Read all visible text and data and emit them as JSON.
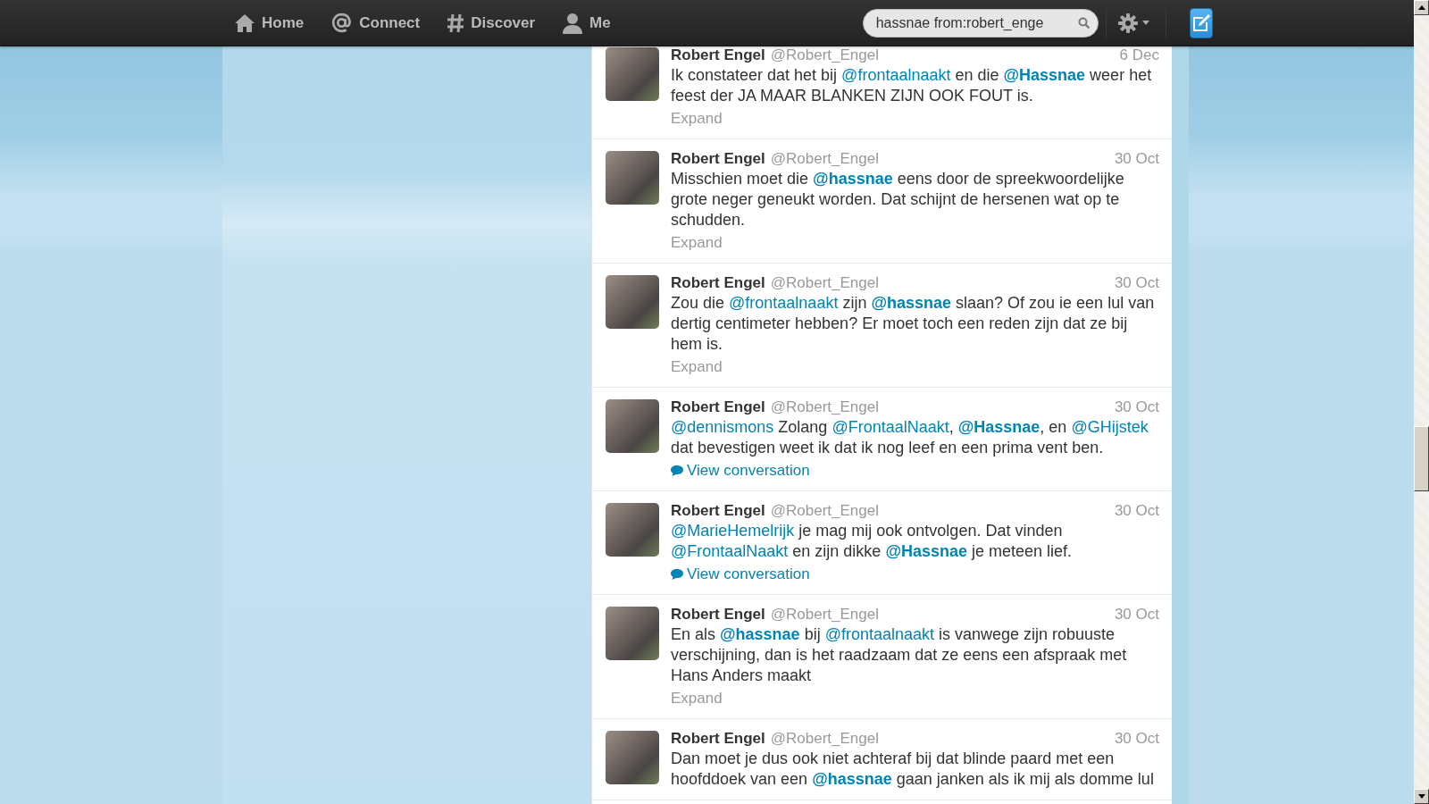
{
  "nav": {
    "items": [
      {
        "label": "Home"
      },
      {
        "label": "Connect"
      },
      {
        "label": "Discover"
      },
      {
        "label": "Me"
      }
    ],
    "search": {
      "value": "hassnae from:robert_enge"
    }
  },
  "tweets": [
    {
      "name": "Robert Engel",
      "handle": "@Robert_Engel",
      "time": "6 Dec",
      "segments": [
        {
          "kind": "text",
          "text": "Ik constateer dat het bij "
        },
        {
          "kind": "mention",
          "text": "@frontaalnaakt",
          "bold": false
        },
        {
          "kind": "text",
          "text": " en die "
        },
        {
          "kind": "mention",
          "text": "@Hassnae",
          "bold": true
        },
        {
          "kind": "text",
          "text": " weer het feest der JA MAAR BLANKEN ZIJN OOK FOUT is."
        }
      ],
      "action": {
        "kind": "expand",
        "label": "Expand"
      }
    },
    {
      "name": "Robert Engel",
      "handle": "@Robert_Engel",
      "time": "30 Oct",
      "segments": [
        {
          "kind": "text",
          "text": "Misschien moet die "
        },
        {
          "kind": "mention",
          "text": "@hassnae",
          "bold": true
        },
        {
          "kind": "text",
          "text": " eens door de spreekwoordelijke grote neger geneukt worden. Dat schijnt de hersenen wat op te schudden."
        }
      ],
      "action": {
        "kind": "expand",
        "label": "Expand"
      }
    },
    {
      "name": "Robert Engel",
      "handle": "@Robert_Engel",
      "time": "30 Oct",
      "segments": [
        {
          "kind": "text",
          "text": "Zou die "
        },
        {
          "kind": "mention",
          "text": "@frontaalnaakt",
          "bold": false
        },
        {
          "kind": "text",
          "text": " zijn "
        },
        {
          "kind": "mention",
          "text": "@hassnae",
          "bold": true
        },
        {
          "kind": "text",
          "text": " slaan? Of zou ie een lul van dertig centimeter hebben? Er moet toch een reden zijn dat ze bij hem is."
        }
      ],
      "action": {
        "kind": "expand",
        "label": "Expand"
      }
    },
    {
      "name": "Robert Engel",
      "handle": "@Robert_Engel",
      "time": "30 Oct",
      "segments": [
        {
          "kind": "mention",
          "text": "@dennismons",
          "bold": false
        },
        {
          "kind": "text",
          "text": " Zolang "
        },
        {
          "kind": "mention",
          "text": "@FrontaalNaakt",
          "bold": false
        },
        {
          "kind": "text",
          "text": ", "
        },
        {
          "kind": "mention",
          "text": "@Hassnae",
          "bold": true
        },
        {
          "kind": "text",
          "text": ", en "
        },
        {
          "kind": "mention",
          "text": "@GHijstek",
          "bold": false
        },
        {
          "kind": "text",
          "text": " dat bevestigen weet ik dat ik nog leef en een prima vent ben."
        }
      ],
      "action": {
        "kind": "conversation",
        "label": "View conversation"
      }
    },
    {
      "name": "Robert Engel",
      "handle": "@Robert_Engel",
      "time": "30 Oct",
      "segments": [
        {
          "kind": "mention",
          "text": "@MarieHemelrijk",
          "bold": false
        },
        {
          "kind": "text",
          "text": " je mag mij ook ontvolgen. Dat vinden "
        },
        {
          "kind": "mention",
          "text": "@FrontaalNaakt",
          "bold": false
        },
        {
          "kind": "text",
          "text": " en zijn dikke "
        },
        {
          "kind": "mention",
          "text": "@Hassnae",
          "bold": true
        },
        {
          "kind": "text",
          "text": " je meteen lief."
        }
      ],
      "action": {
        "kind": "conversation",
        "label": "View conversation"
      }
    },
    {
      "name": "Robert Engel",
      "handle": "@Robert_Engel",
      "time": "30 Oct",
      "segments": [
        {
          "kind": "text",
          "text": "En als "
        },
        {
          "kind": "mention",
          "text": "@hassnae",
          "bold": true
        },
        {
          "kind": "text",
          "text": " bij "
        },
        {
          "kind": "mention",
          "text": "@frontaalnaakt",
          "bold": false
        },
        {
          "kind": "text",
          "text": " is vanwege zijn robuuste verschijning, dan is het raadzaam dat ze eens een afspraak met Hans Anders maakt"
        }
      ],
      "action": {
        "kind": "expand",
        "label": "Expand"
      }
    },
    {
      "name": "Robert Engel",
      "handle": "@Robert_Engel",
      "time": "30 Oct",
      "segments": [
        {
          "kind": "text",
          "text": "Dan moet je dus ook niet achteraf bij dat blinde paard met een hoofddoek van een "
        },
        {
          "kind": "mention",
          "text": "@hassnae",
          "bold": true
        },
        {
          "kind": "text",
          "text": " gaan janken als ik mij als domme lul"
        }
      ]
    }
  ]
}
